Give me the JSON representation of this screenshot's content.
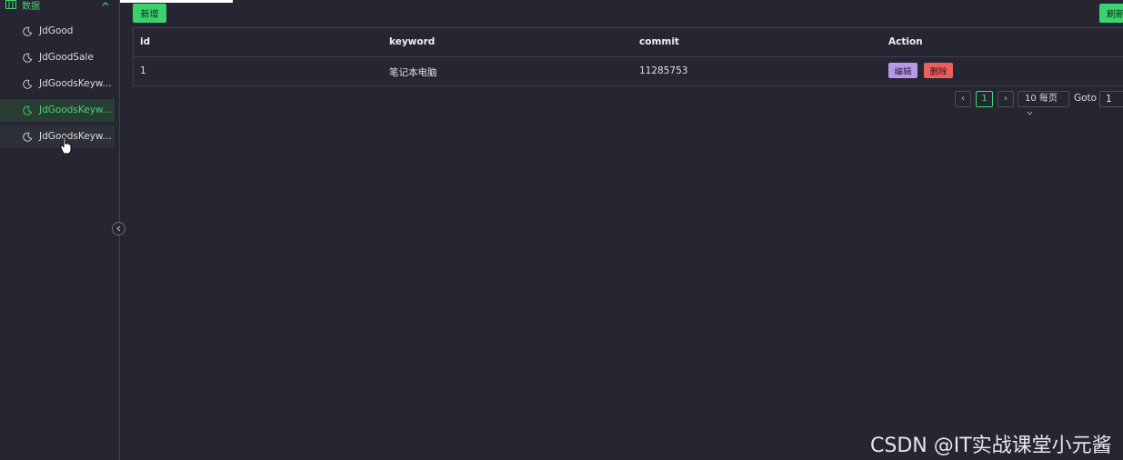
{
  "sidebar": {
    "group_label": "数据",
    "items": [
      {
        "label": "JdGood"
      },
      {
        "label": "JdGoodSale"
      },
      {
        "label": "JdGoodsKeyw..."
      },
      {
        "label": "JdGoodsKeyw..."
      },
      {
        "label": "JdGoodsKeyw..."
      }
    ]
  },
  "toolbar": {
    "add_label": "新增",
    "refresh_label": "刷新"
  },
  "table": {
    "columns": [
      "id",
      "keyword",
      "commit",
      "Action"
    ],
    "rows": [
      {
        "id": "1",
        "keyword": "笔记本电脑",
        "commit": "11285753",
        "edit_label": "编辑",
        "delete_label": "删除"
      }
    ]
  },
  "pagination": {
    "prev": "‹",
    "current_page": "1",
    "next": "›",
    "page_size": "10 每页",
    "goto_label": "Goto",
    "goto_value": "1"
  },
  "watermark": "CSDN @IT实战课堂小元酱",
  "colors": {
    "accent": "#42d66f",
    "background": "#252631",
    "edit": "#b79ae6",
    "delete": "#ec5f5f"
  }
}
